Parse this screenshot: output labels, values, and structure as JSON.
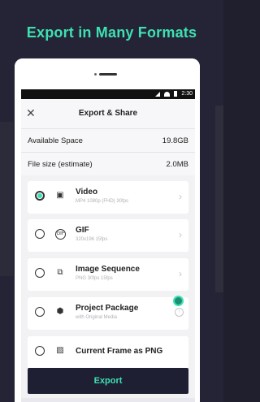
{
  "headline": "Export in Many Formats",
  "status": {
    "time": "2:30"
  },
  "dialog": {
    "title": "Export & Share",
    "available_space_label": "Available Space",
    "available_space_value": "19.8GB",
    "file_size_label": "File size (estimate)",
    "file_size_value": "2.0MB"
  },
  "formats": [
    {
      "label": "Video",
      "sub": "MP4 1080p (FHD) 30fps",
      "icon": "video-icon",
      "selected": true
    },
    {
      "label": "GIF",
      "sub": "320x196 15fps",
      "icon": "gif-icon",
      "selected": false
    },
    {
      "label": "Image Sequence",
      "sub": "PNG 30fps 15fps",
      "icon": "image-sequence-icon",
      "selected": false
    },
    {
      "label": "Project Package",
      "sub": "with Original Media",
      "icon": "package-icon",
      "selected": false
    },
    {
      "label": "Current Frame as PNG",
      "sub": "",
      "icon": "image-icon",
      "selected": false
    }
  ],
  "export_button": "Export",
  "colors": {
    "accent": "#3ee0b2",
    "dark": "#1e1f33",
    "background": "#242436"
  }
}
